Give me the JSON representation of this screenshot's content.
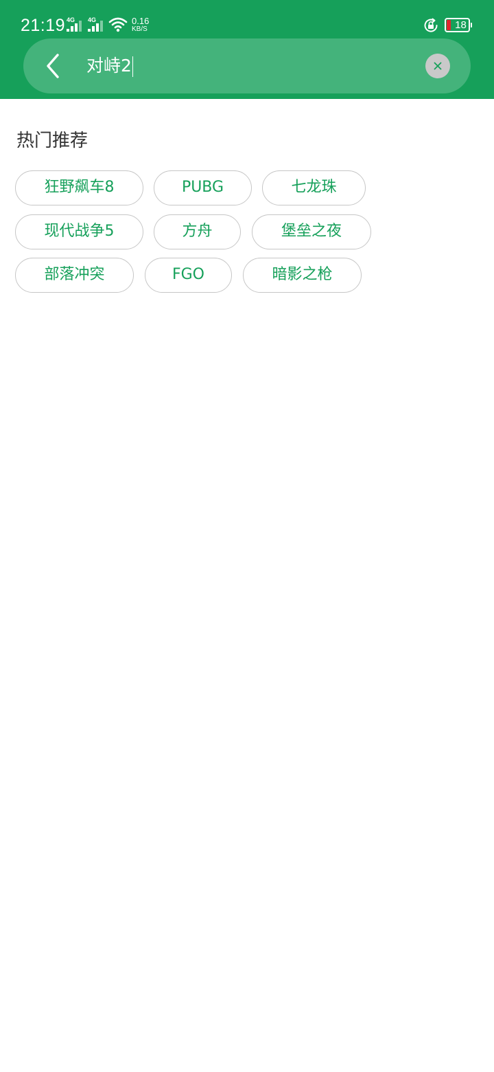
{
  "status_bar": {
    "time": "21:19",
    "network_1": "4G",
    "network_2": "4G",
    "net_speed_value": "0.16",
    "net_speed_unit": "KB/S",
    "battery_level": "18",
    "icons": [
      "signal-icon",
      "wifi-icon",
      "rotation-lock-icon",
      "battery-icon"
    ]
  },
  "search": {
    "query": "对峙2",
    "back_icon": "chevron-left-icon",
    "clear_icon": "close-icon"
  },
  "hot": {
    "title": "热门推荐",
    "tags": [
      "狂野飙车8",
      "PUBG",
      "七龙珠",
      "现代战争5",
      "方舟",
      "堡垒之夜",
      "部落冲突",
      "FGO",
      "暗影之枪"
    ]
  },
  "colors": {
    "brand_green": "#16a05a",
    "tag_border": "#c6c6c6",
    "battery_low": "#e0262e"
  }
}
